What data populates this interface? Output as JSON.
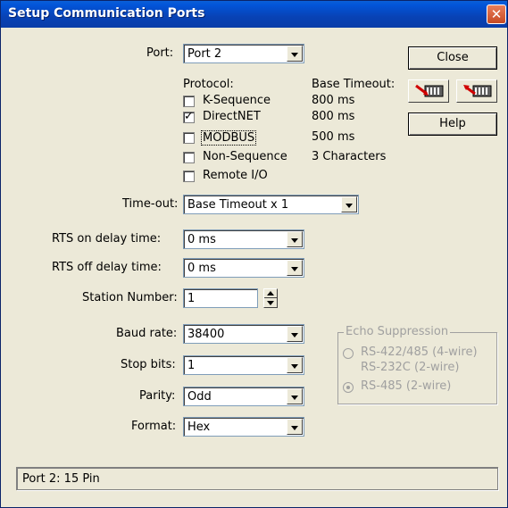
{
  "window": {
    "title": "Setup Communication Ports",
    "close_glyph": "✕"
  },
  "port": {
    "label": "Port:",
    "value": "Port 2"
  },
  "protocol": {
    "header": "Protocol:",
    "timeout_header": "Base Timeout:",
    "items": [
      {
        "label": "K-Sequence",
        "checked": false,
        "timeout": "800 ms"
      },
      {
        "label": "DirectNET",
        "checked": true,
        "timeout": "800 ms"
      },
      {
        "label": "MODBUS",
        "checked": false,
        "timeout": "500 ms"
      },
      {
        "label": "Non-Sequence",
        "checked": false,
        "timeout": "3 Characters"
      },
      {
        "label": "Remote I/O",
        "checked": false,
        "timeout": ""
      }
    ]
  },
  "timeout": {
    "label": "Time-out:",
    "value": "Base Timeout x 1"
  },
  "rts_on": {
    "label": "RTS on delay time:",
    "value": "0 ms"
  },
  "rts_off": {
    "label": "RTS off delay time:",
    "value": "0 ms"
  },
  "station": {
    "label": "Station Number:",
    "value": "1"
  },
  "baud": {
    "label": "Baud rate:",
    "value": "38400"
  },
  "stop_bits": {
    "label": "Stop bits:",
    "value": "1"
  },
  "parity": {
    "label": "Parity:",
    "value": "Odd"
  },
  "format": {
    "label": "Format:",
    "value": "Hex"
  },
  "buttons": {
    "close": "Close",
    "help": "Help"
  },
  "echo": {
    "legend": "Echo Suppression",
    "option1_line1": "RS-422/485 (4-wire)",
    "option1_line2": "RS-232C (2-wire)",
    "option2": "RS-485 (2-wire)",
    "selected": "RS-485 (2-wire)"
  },
  "status": {
    "text": "Port 2: 15 Pin"
  },
  "colors": {
    "title_bar": "#0842B5",
    "dialog_bg": "#ECE9D8",
    "disabled_text": "#a0a0a0"
  },
  "icons": [
    "close-icon",
    "plc-read-icon",
    "plc-write-icon",
    "dropdown-arrow-icon",
    "spinner-icon",
    "checkbox-icon",
    "radio-icon"
  ]
}
